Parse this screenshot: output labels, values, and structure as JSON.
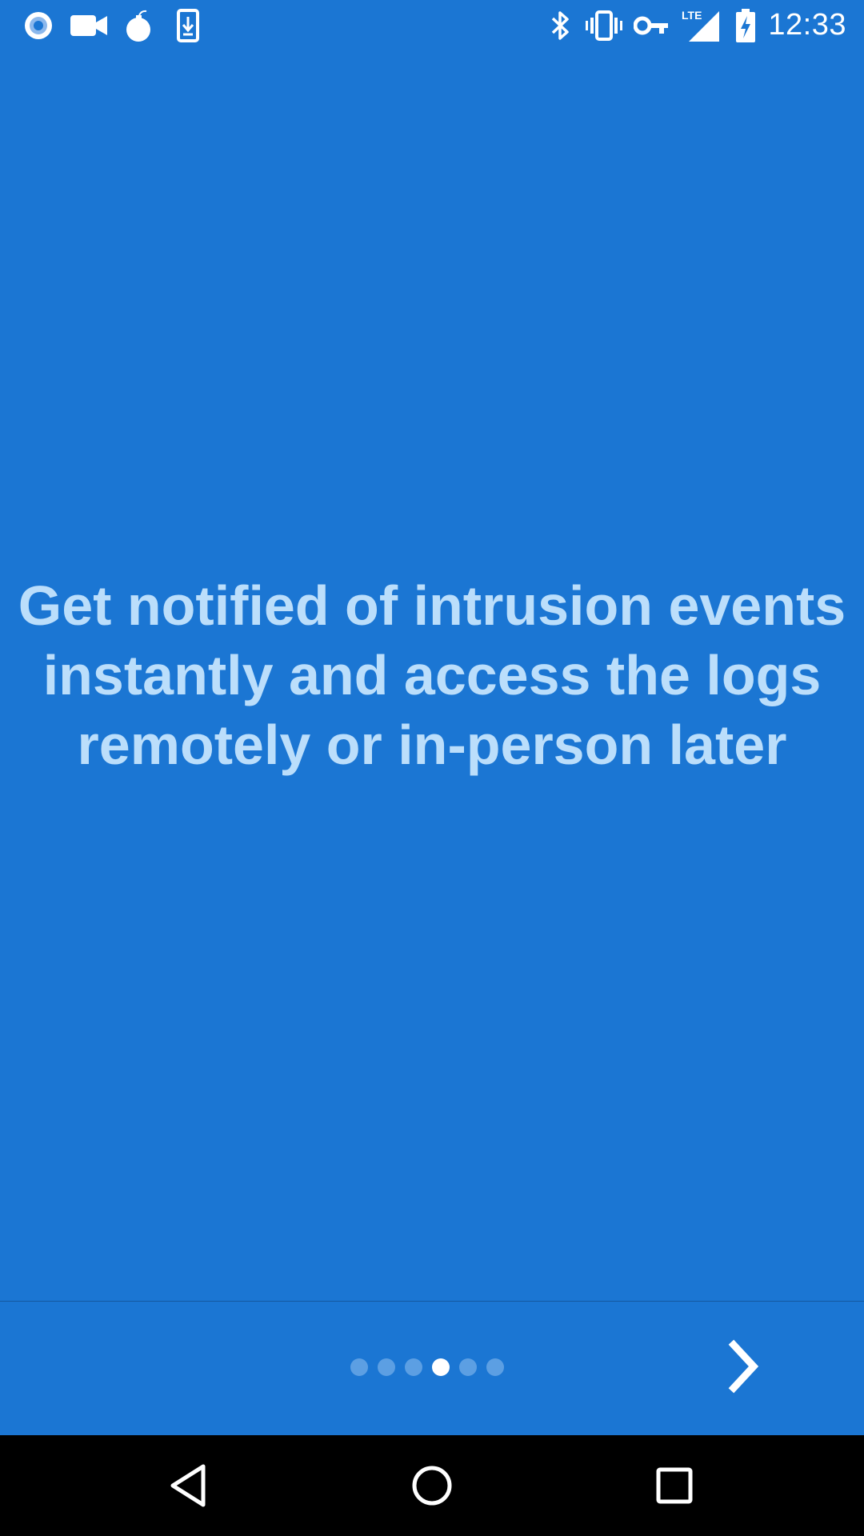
{
  "status_bar": {
    "time": "12:33",
    "left_icons": [
      "record-icon",
      "video-camera-icon",
      "bomb-icon",
      "download-phone-icon"
    ],
    "right_icons": [
      "bluetooth-icon",
      "vibrate-icon",
      "vpn-key-icon",
      "lte-signal-icon",
      "battery-charging-icon"
    ],
    "network_label": "LTE"
  },
  "onboarding": {
    "headline": "Get notified of intrusion events instantly and access the logs remotely or in-person later",
    "page_count": 6,
    "current_page": 4,
    "next_icon": "chevron-right-icon"
  },
  "nav_bar": {
    "buttons": [
      "back-icon",
      "home-icon",
      "recents-icon"
    ]
  },
  "colors": {
    "background": "#1b76d3",
    "headline_text": "#bbdefb",
    "dot_inactive": "#5c9fe3",
    "dot_active": "#ffffff",
    "nav_background": "#000000"
  }
}
